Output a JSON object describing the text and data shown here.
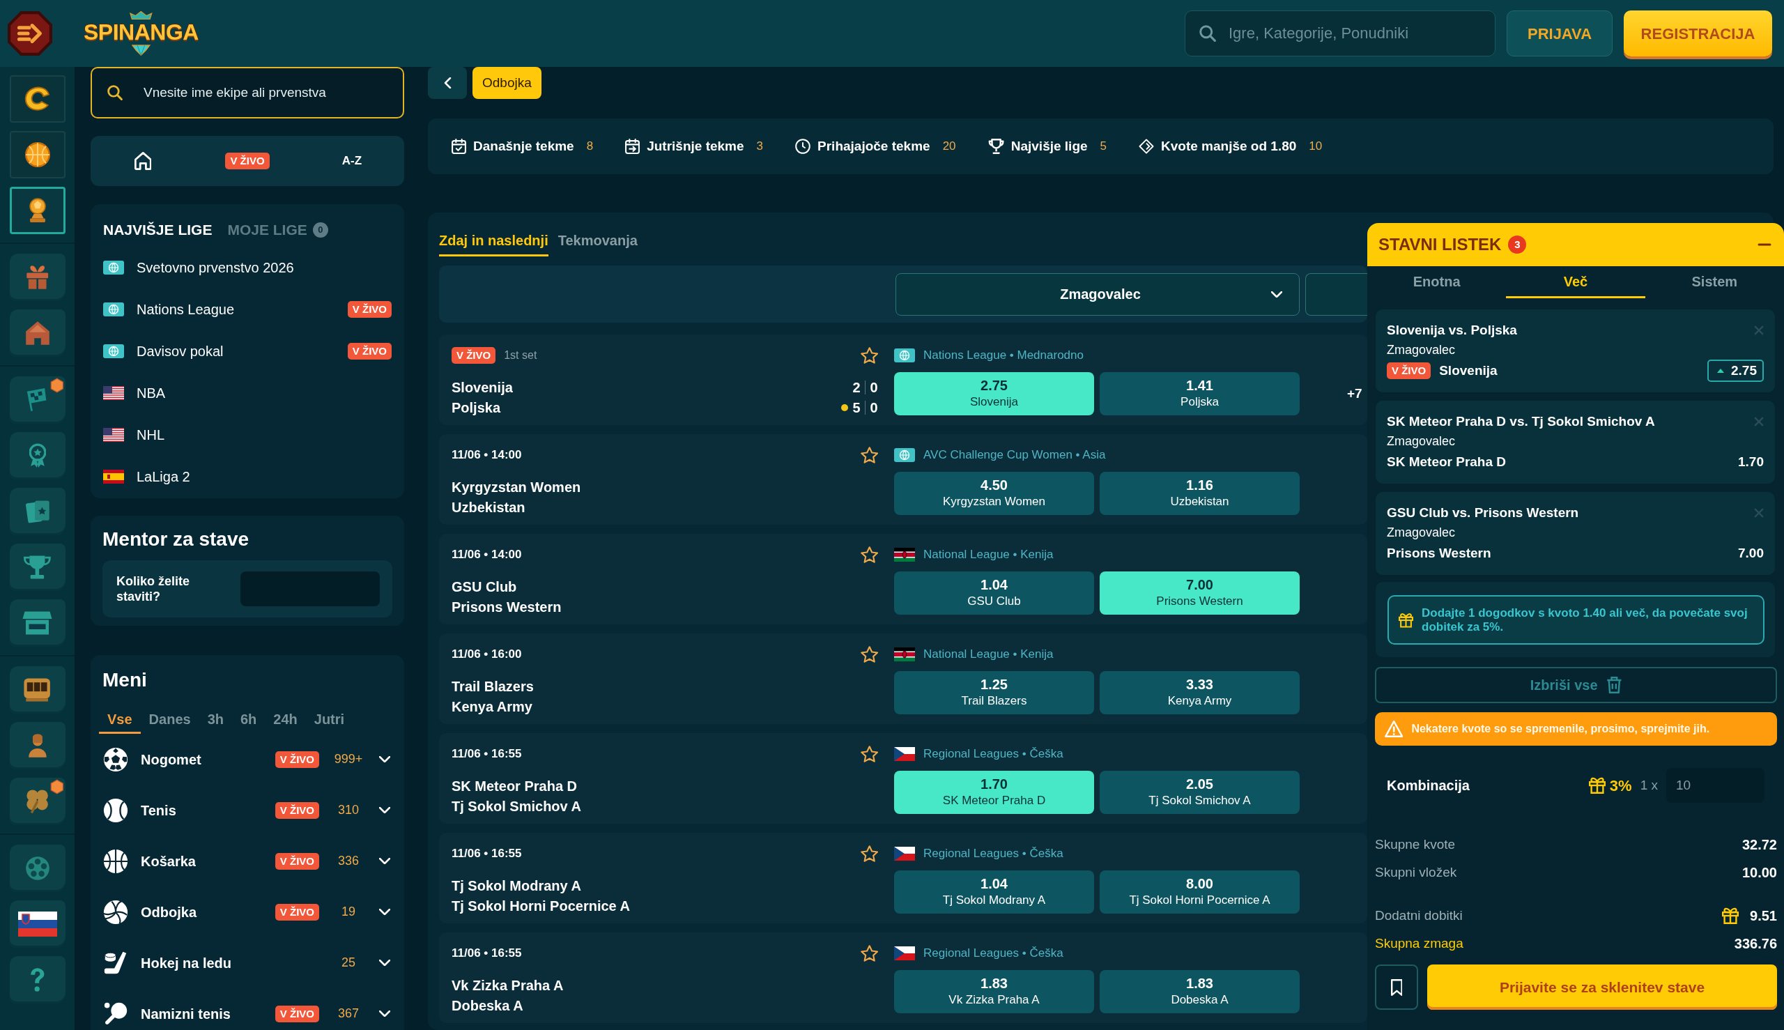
{
  "header": {
    "logo_text": "SPINANGA",
    "search": {
      "placeholder": "Igre, Kategorije, Ponudniki"
    },
    "buttons": [
      {
        "kind": "secondary",
        "label": "PRIJAVA"
      },
      {
        "kind": "primary",
        "label": "REGISTRACIJA"
      }
    ]
  },
  "rail": {
    "groups": [
      {
        "kind": "framed",
        "items": [
          {
            "selected": false,
            "badge": false
          },
          {
            "selected": false,
            "badge": false
          },
          {
            "selected": true,
            "badge": false
          }
        ]
      },
      {
        "kind": "stone",
        "items": [
          {
            "selected": false,
            "badge": false
          },
          {
            "selected": false,
            "badge": false
          }
        ]
      },
      {
        "kind": "stone",
        "items": [
          {
            "selected": false,
            "badge": true
          },
          {
            "selected": false,
            "badge": false
          },
          {
            "selected": false,
            "badge": false
          },
          {
            "selected": false,
            "badge": false
          },
          {
            "selected": false,
            "badge": false
          }
        ]
      },
      {
        "kind": "stone",
        "items": [
          {
            "selected": false,
            "badge": false
          },
          {
            "selected": false,
            "badge": false
          },
          {
            "selected": false,
            "badge": true
          }
        ]
      },
      {
        "kind": "stone",
        "items": [
          {
            "selected": false,
            "badge": false
          },
          {
            "selected": false,
            "badge": false
          },
          {
            "selected": false,
            "badge": false
          }
        ]
      }
    ]
  },
  "left_panel": {
    "search": {
      "placeholder": "Vnesite ime ekipe ali prvenstva"
    },
    "quick_nav": [
      {
        "kind": "home"
      },
      {
        "kind": "live",
        "label": "V ŽIVO"
      },
      {
        "kind": "text",
        "label": "A-Z"
      }
    ],
    "leagues": {
      "tabs": [
        {
          "label": "NAJVIŠJE LIGE",
          "selected": true
        },
        {
          "label": "MOJE LIGE",
          "selected": false,
          "count": "0"
        }
      ],
      "items": [
        {
          "name": "Svetovno prvenstvo 2026"
        },
        {
          "name": "Nations League",
          "badge": "V ŽIVO"
        },
        {
          "name": "Davisov pokal",
          "badge": "V ŽIVO"
        },
        {
          "name": "NBA"
        },
        {
          "name": "NHL"
        },
        {
          "name": "LaLiga 2"
        }
      ]
    },
    "mentor": {
      "title": "Mentor za stave",
      "label": "Koliko želite staviti?"
    },
    "menu": {
      "title": "Meni",
      "filters": [
        {
          "label": "Vse",
          "selected": true
        },
        {
          "label": "Danes",
          "selected": false
        },
        {
          "label": "3h",
          "selected": false
        },
        {
          "label": "6h",
          "selected": false
        },
        {
          "label": "24h",
          "selected": false
        },
        {
          "label": "Jutri",
          "selected": false
        }
      ],
      "sports": [
        {
          "name": "Nogomet",
          "badge": "V ŽIVO",
          "count": "999+",
          "expanded": false
        },
        {
          "name": "Tenis",
          "badge": "V ŽIVO",
          "count": "310",
          "expanded": false
        },
        {
          "name": "Košarka",
          "badge": "V ŽIVO",
          "count": "336",
          "expanded": false
        },
        {
          "name": "Odbojka",
          "badge": "V ŽIVO",
          "count": "19",
          "expanded": false
        },
        {
          "name": "Hokej na ledu",
          "count": "25",
          "expanded": false
        },
        {
          "name": "Namizni tenis",
          "badge": "V ŽIVO",
          "count": "367",
          "expanded": false
        }
      ]
    }
  },
  "breadcrumb": {
    "label": "Odbojka"
  },
  "quick_filters": [
    {
      "label": "Današnje tekme",
      "count": "8"
    },
    {
      "label": "Jutrišnje tekme",
      "count": "3"
    },
    {
      "label": "Prihajajoče tekme",
      "count": "20"
    },
    {
      "label": "Najvišje lige",
      "count": "5"
    },
    {
      "label": "Kvote manjše od 1.80",
      "count": "10"
    }
  ],
  "matches": {
    "tabs": [
      {
        "label": "Zdaj in naslednji",
        "selected": true
      },
      {
        "label": "Tekmovanja",
        "selected": false
      }
    ],
    "market": {
      "value": "Zmagovalec"
    },
    "rows": [
      {
        "kind": "live",
        "badge": "V ŽIVO",
        "period": "1st set",
        "favorite": false,
        "league": "Nations League • Mednarodno",
        "teams": [
          {
            "name": "Slovenija",
            "score": [
              "2",
              "0"
            ],
            "serving": false
          },
          {
            "name": "Poljska",
            "score": [
              "5",
              "0"
            ],
            "serving": true
          }
        ],
        "odds": [
          {
            "value": "2.75",
            "label": "Slovenija",
            "selected": true
          },
          {
            "value": "1.41",
            "label": "Poljska",
            "selected": false
          }
        ],
        "more": "+7"
      },
      {
        "kind": "scheduled",
        "time": "11/06 • 14:00",
        "favorite": false,
        "league": "AVC Challenge Cup Women • Asia",
        "teams": [
          {
            "name": "Kyrgyzstan Women"
          },
          {
            "name": "Uzbekistan"
          }
        ],
        "odds": [
          {
            "value": "4.50",
            "label": "Kyrgyzstan Women",
            "selected": false
          },
          {
            "value": "1.16",
            "label": "Uzbekistan",
            "selected": false
          }
        ]
      },
      {
        "kind": "scheduled",
        "time": "11/06 • 14:00",
        "favorite": false,
        "league": "National League • Kenija",
        "teams": [
          {
            "name": "GSU Club"
          },
          {
            "name": "Prisons Western"
          }
        ],
        "odds": [
          {
            "value": "1.04",
            "label": "GSU Club",
            "selected": false
          },
          {
            "value": "7.00",
            "label": "Prisons Western",
            "selected": true
          }
        ]
      },
      {
        "kind": "scheduled",
        "time": "11/06 • 16:00",
        "favorite": false,
        "league": "National League • Kenija",
        "teams": [
          {
            "name": "Trail Blazers"
          },
          {
            "name": "Kenya Army"
          }
        ],
        "odds": [
          {
            "value": "1.25",
            "label": "Trail Blazers",
            "selected": false
          },
          {
            "value": "3.33",
            "label": "Kenya Army",
            "selected": false
          }
        ]
      },
      {
        "kind": "scheduled",
        "time": "11/06 • 16:55",
        "favorite": false,
        "league": "Regional Leagues • Češka",
        "teams": [
          {
            "name": "SK Meteor Praha D"
          },
          {
            "name": "Tj Sokol Smichov A"
          }
        ],
        "odds": [
          {
            "value": "1.70",
            "label": "SK Meteor Praha D",
            "selected": true
          },
          {
            "value": "2.05",
            "label": "Tj Sokol Smichov A",
            "selected": false
          }
        ]
      },
      {
        "kind": "scheduled",
        "time": "11/06 • 16:55",
        "favorite": false,
        "league": "Regional Leagues • Češka",
        "teams": [
          {
            "name": "Tj Sokol Modrany A"
          },
          {
            "name": "Tj Sokol Horni Pocernice A"
          }
        ],
        "odds": [
          {
            "value": "1.04",
            "label": "Tj Sokol Modrany A",
            "selected": false
          },
          {
            "value": "8.00",
            "label": "Tj Sokol Horni Pocernice A",
            "selected": false
          }
        ]
      },
      {
        "kind": "scheduled",
        "time": "11/06 • 16:55",
        "favorite": false,
        "league": "Regional Leagues • Češka",
        "teams": [
          {
            "name": "Vk Zizka Praha A"
          },
          {
            "name": "Dobeska A"
          }
        ],
        "odds": [
          {
            "value": "1.83",
            "label": "Vk Zizka Praha A",
            "selected": false
          },
          {
            "value": "1.83",
            "label": "Dobeska A",
            "selected": false
          }
        ]
      }
    ]
  },
  "betslip": {
    "title": "STAVNI LISTEK",
    "count": "3",
    "tabs": [
      {
        "label": "Enotna",
        "selected": false
      },
      {
        "label": "Več",
        "selected": true
      },
      {
        "label": "Sistem",
        "selected": false
      }
    ],
    "selections": [
      {
        "event": "Slovenija vs. Poljska",
        "market": "Zmagovalec",
        "badge": "V ŽIVO",
        "pick": "Slovenija",
        "odds": "2.75",
        "odds_changed": true
      },
      {
        "event": "SK Meteor Praha D vs. Tj Sokol Smichov A",
        "market": "Zmagovalec",
        "pick": "SK Meteor Praha D",
        "odds": "1.70",
        "odds_changed": false
      },
      {
        "event": "GSU Club vs. Prisons Western",
        "market": "Zmagovalec",
        "pick": "Prisons Western",
        "odds": "7.00",
        "odds_changed": false
      }
    ],
    "promo": "Dodajte 1 dogodkov s kvoto 1.40 ali več, da povečate svoj dobitek za 5%.",
    "clear_button": "Izbriši vse",
    "warning": "Nekatere kvote so se spremenile, prosimo, sprejmite jih.",
    "combination": {
      "label": "Kombinacija",
      "bonus": "3%",
      "multiplier": "1 x",
      "stake": "10"
    },
    "totals": [
      {
        "kind": "plain",
        "label": "Skupne kvote",
        "value": "32.72"
      },
      {
        "kind": "plain",
        "label": "Skupni vložek",
        "value": "10.00"
      },
      {
        "kind": "bonus",
        "label": "Dodatni dobitki",
        "value": "9.51"
      },
      {
        "kind": "highlight",
        "label": "Skupna zmaga",
        "value": "336.76"
      }
    ],
    "submit": "Prijavite se za sklenitev stave"
  }
}
